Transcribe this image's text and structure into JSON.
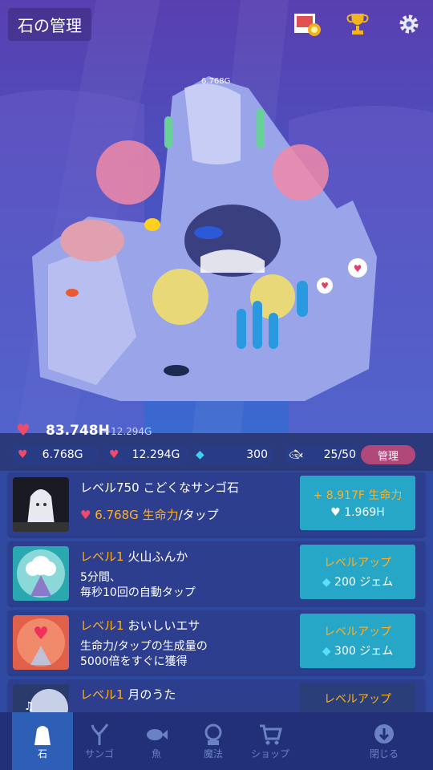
{
  "header": {
    "title": "石の管理",
    "icons": [
      "gallery-icon",
      "trophy-icon",
      "gear-icon"
    ]
  },
  "scene": {
    "stone_label": "6.768G"
  },
  "stats": {
    "life": "83.748H",
    "life_rate": "+12.294G",
    "per_tap": "6.768G",
    "per_sec": "12.294G",
    "gems": "300",
    "fish_count": "25/50",
    "manage_label": "管理"
  },
  "cards": [
    {
      "level": "レベル750",
      "name": "こどくなサンゴ石",
      "desc_value": "6.768G 生命力",
      "desc_suffix": "/タップ",
      "btn_line1": "+ 8.917F 生命力",
      "btn_line2": "1.969H",
      "btn_icon": "heart-icon",
      "thumb": "stone"
    },
    {
      "level": "レベル1",
      "name": "火山ふんか",
      "desc_line1": "5分間、",
      "desc_line2": "毎秒10回の自動タップ",
      "btn_line1": "レベルアップ",
      "btn_line2": "200 ジェム",
      "btn_icon": "gem-icon",
      "thumb": "volcano"
    },
    {
      "level": "レベル1",
      "name": "おいしいエサ",
      "desc_line1": "生命力/タップの生成量の",
      "desc_line2": "5000倍をすぐに獲得",
      "btn_line1": "レベルアップ",
      "btn_line2": "300 ジェム",
      "btn_icon": "gem-icon",
      "thumb": "food"
    },
    {
      "level": "レベル1",
      "name": "月のうた",
      "btn_line1": "レベルアップ",
      "thumb": "moon"
    }
  ],
  "tabs": [
    {
      "label": "石",
      "icon": "stone-icon",
      "active": true
    },
    {
      "label": "サンゴ",
      "icon": "coral-icon"
    },
    {
      "label": "魚",
      "icon": "fish-icon"
    },
    {
      "label": "魔法",
      "icon": "magic-icon"
    },
    {
      "label": "ショップ",
      "icon": "cart-icon"
    },
    {
      "label": "閉じる",
      "icon": "close-down-icon"
    }
  ],
  "colors": {
    "accent": "#ffb020",
    "button": "#27a7c8",
    "manage": "#b0487a",
    "tab_active": "#2e5fb6"
  }
}
